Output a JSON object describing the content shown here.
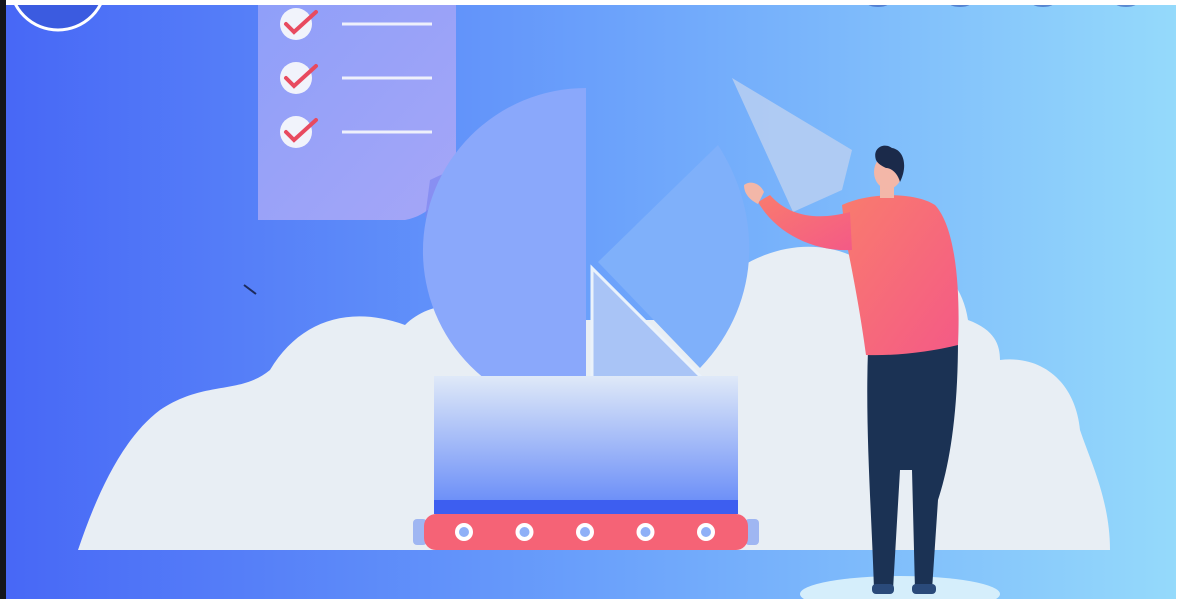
{
  "illustration": {
    "checklist": {
      "items": [
        {
          "icon": "check-icon",
          "checked": true
        },
        {
          "icon": "check-icon",
          "checked": true
        },
        {
          "icon": "check-icon",
          "checked": true
        }
      ]
    },
    "conveyor": {
      "roller_count": 5,
      "roller_icon": "roller-icon"
    },
    "colors": {
      "background_start": "#4a6cf7",
      "background_end": "#93d8fb",
      "cloud": "#e8eef4",
      "pie_main": "#8aa8fb",
      "pie_wedge": "#7aabf9",
      "shirt": "#f8627e",
      "pants": "#1b3254",
      "conveyor": "#f56376",
      "check": "#e84a5f"
    }
  }
}
